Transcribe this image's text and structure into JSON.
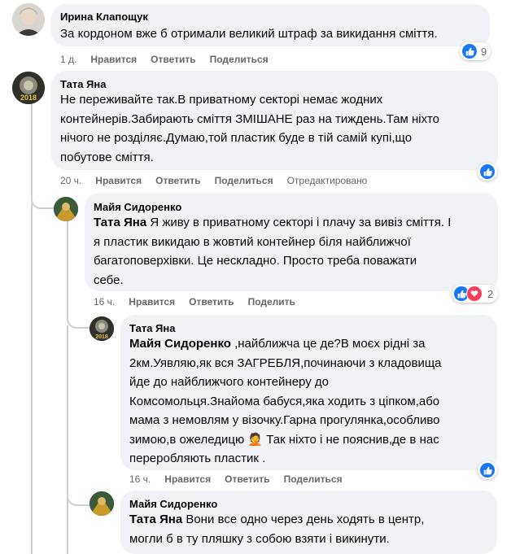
{
  "comments": [
    {
      "author": "Ирина Клапощук",
      "text": "За кордоном вже б отримали великий штраф за викидання сміття.",
      "time": "1 д.",
      "like": "Нравится",
      "reply": "Ответить",
      "share": "Поделиться",
      "reaction_count": "9"
    },
    {
      "author": "Тата Яна",
      "text": "Не переживайте так.В приватному секторі немає жодних\nконтейнерів.Забирають сміття ЗМІШАНЕ раз на тиждень.Там ніхто\nнічого не розділяє.Думаю,той пластик буде в тій самій купі,що\nпобутове сміття.",
      "time": "20 ч.",
      "like": "Нравится",
      "reply": "Ответить",
      "share": "Поделиться",
      "edited": "Отредактировано",
      "avatar_label": "2018"
    },
    {
      "author": "Майя Сидоренко",
      "mention": "Тата Яна",
      "text": " Я живу в приватному секторі і плачу за вивіз сміття. І\nя пластик викидаю в жовтий контейнер біля найближчої\nбагатоповерхівки. Це нескладно. Просто треба поважати\nсебе.",
      "time": "16 ч.",
      "like": "Нравится",
      "reply": "Ответить",
      "share": "Поделить",
      "reaction_count": "2"
    },
    {
      "author": "Тата Яна",
      "mention": "Майя Сидоренко",
      "text": " ,найближча це де?В моєх рідні за\n2км.Уявляю,як вся ЗАГРЕБЛЯ,починаючи з кладовища\nйде до найближчого контейнеру до\nКомсомольця.Знайома бабуся,яка ходить з ціпком,або\nмама з немовлям у візочку.Гарна прогулянка,особливо\nзимою,в ожеледицю 🤦 Так ніхто і не пояснив,де в нас\nпереробляють пластик .",
      "time": "16 ч.",
      "like": "Нравится",
      "reply": "Ответить",
      "share": "Поделиться",
      "avatar_label": "2018"
    },
    {
      "author": "Майя Сидоренко",
      "mention": "Тата Яна",
      "text": " Вони все одно через день ходять в центр,\nмогли б в ту пляшку з собою взяти і викинути."
    }
  ]
}
